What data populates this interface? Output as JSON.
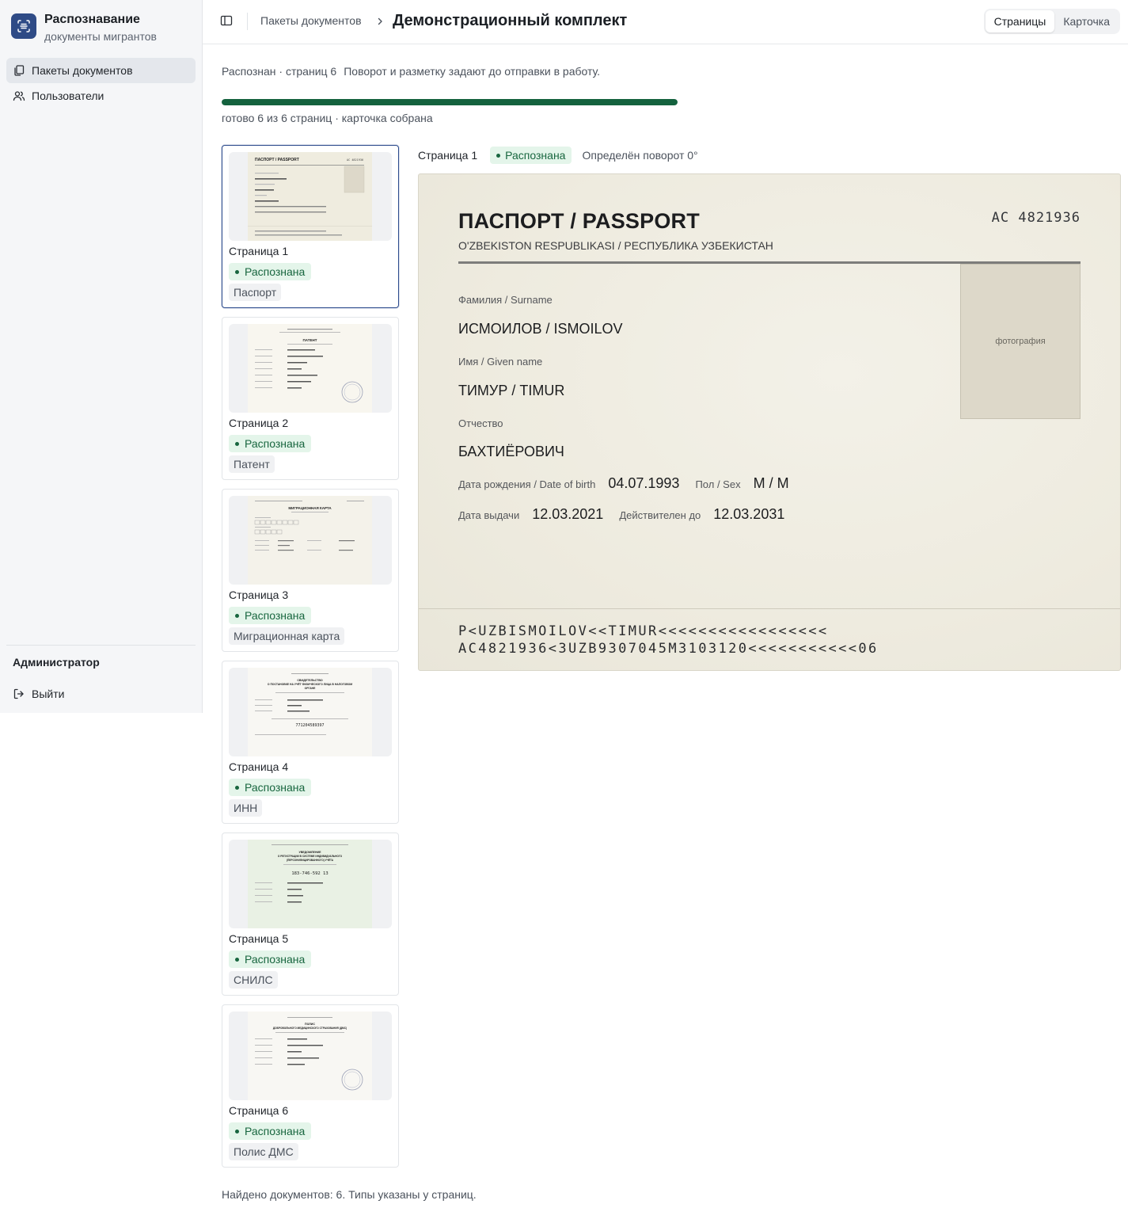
{
  "app": {
    "title": "Распознавание",
    "subtitle": "документы мигрантов",
    "logo_icon": "document-scan-icon",
    "accent": "#2f4b86"
  },
  "sidebar": {
    "items": [
      {
        "label": "Пакеты документов",
        "icon": "documents-icon",
        "active": true
      },
      {
        "label": "Пользователи",
        "icon": "users-icon",
        "active": false
      }
    ],
    "role": "Администратор",
    "logout": "Выйти"
  },
  "header": {
    "breadcrumb": "Пакеты документов",
    "title": "Демонстрационный комплект",
    "tabs": [
      {
        "label": "Страницы",
        "active": true
      },
      {
        "label": "Карточка",
        "active": false
      }
    ]
  },
  "status": {
    "summary": "Распознан · страниц 6",
    "hint": "Поворот и разметку задают до отправки в работу.",
    "progress_fraction": 1.0,
    "progress_text": "готово 6 из 6 страниц · карточка собрана",
    "progress_color": "#14623e"
  },
  "pages": [
    {
      "label": "Страница 1",
      "status": "Распознана",
      "type": "Паспорт",
      "selected": true
    },
    {
      "label": "Страница 2",
      "status": "Распознана",
      "type": "Патент",
      "selected": false
    },
    {
      "label": "Страница 3",
      "status": "Распознана",
      "type": "Миграционная карта",
      "selected": false
    },
    {
      "label": "Страница 4",
      "status": "Распознана",
      "type": "ИНН",
      "selected": false
    },
    {
      "label": "Страница 5",
      "status": "Распознана",
      "type": "СНИЛС",
      "selected": false
    },
    {
      "label": "Страница 6",
      "status": "Распознана",
      "type": "Полис ДМС",
      "selected": false
    }
  ],
  "preview": {
    "page": "Страница 1",
    "status": "Распознана",
    "rotation": "Определён поворот 0°",
    "document": {
      "title": "ПАСПОРТ / PASSPORT",
      "subtitle": "O'ZBEKISTON RESPUBLIKASI / РЕСПУБЛИКА УЗБЕКИСТАН",
      "number": "AC 4821936",
      "photo": "фотография",
      "surname_label": "Фамилия / Surname",
      "surname": "ИСМОИЛОВ / ISMOILOV",
      "name_label": "Имя / Given name",
      "name": "ТИМУР / TIMUR",
      "patronymic_label": "Отчество",
      "patronymic": "БАХТИЁРОВИЧ",
      "dob_label": "Дата рождения / Date of birth",
      "dob": "04.07.1993",
      "sex_label": "Пол / Sex",
      "sex": "M / M",
      "issue_label": "Дата выдачи",
      "issue": "12.03.2021",
      "valid_label": "Действителен до",
      "valid": "12.03.2031",
      "mrz1": "P<UZBISMOILOV<<TIMUR<<<<<<<<<<<<<<<<<",
      "mrz2": "AC4821936<3UZB9307045M3103120<<<<<<<<<<<06"
    }
  },
  "footer": "Найдено документов: 6. Типы указаны у страниц."
}
